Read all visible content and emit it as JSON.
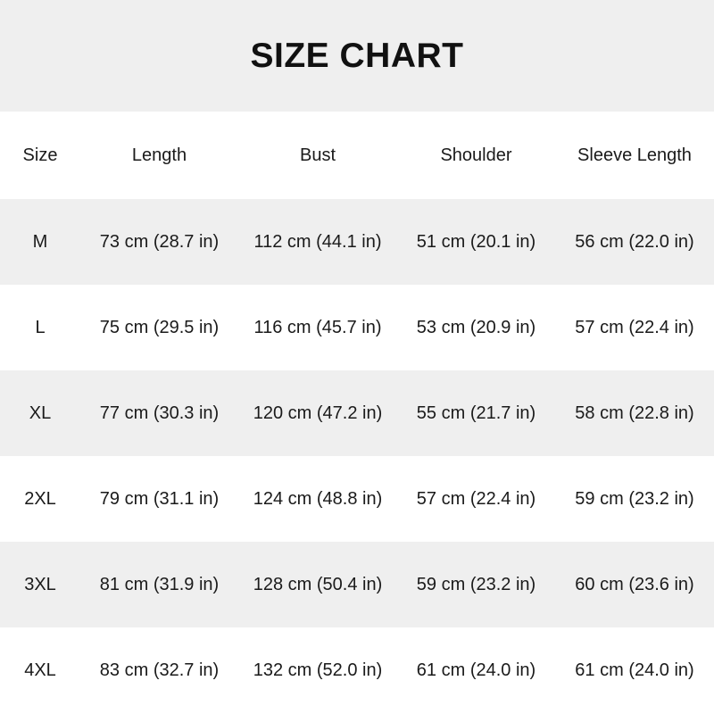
{
  "title": "SIZE CHART",
  "columns": [
    "Size",
    "Length",
    "Bust",
    "Shoulder",
    "Sleeve Length"
  ],
  "rows": [
    [
      "M",
      "73 cm (28.7 in)",
      "112 cm (44.1 in)",
      "51 cm (20.1 in)",
      "56 cm (22.0 in)"
    ],
    [
      "L",
      "75 cm (29.5 in)",
      "116 cm (45.7 in)",
      "53 cm (20.9 in)",
      "57 cm (22.4 in)"
    ],
    [
      "XL",
      "77 cm (30.3 in)",
      "120 cm (47.2 in)",
      "55 cm (21.7 in)",
      "58 cm (22.8 in)"
    ],
    [
      "2XL",
      "79 cm (31.1 in)",
      "124 cm (48.8 in)",
      "57 cm (22.4 in)",
      "59 cm (23.2 in)"
    ],
    [
      "3XL",
      "81 cm (31.9 in)",
      "128 cm (50.4 in)",
      "59 cm (23.2 in)",
      "60 cm (23.6 in)"
    ],
    [
      "4XL",
      "83 cm (32.7 in)",
      "132 cm (52.0 in)",
      "61 cm (24.0 in)",
      "61 cm (24.0 in)"
    ]
  ],
  "colors": {
    "stripe": "#efefef",
    "background": "#ffffff",
    "text": "#1a1a1a"
  }
}
